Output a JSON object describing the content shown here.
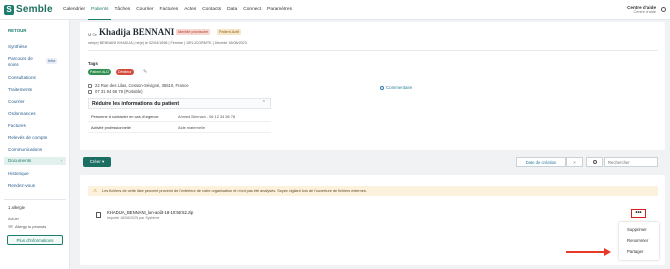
{
  "app": {
    "logo_mark": "S",
    "logo_text": "Semble",
    "accent": "#1e7e6e",
    "clinic_name": "Centre d'aide",
    "clinic_sub": "Centre d'aide"
  },
  "nav": {
    "items": [
      {
        "label": "Calendrier"
      },
      {
        "label": "Patients"
      },
      {
        "label": "Tâches"
      },
      {
        "label": "Courrier"
      },
      {
        "label": "Factures"
      },
      {
        "label": "Actes"
      },
      {
        "label": "Contacts"
      },
      {
        "label": "Data"
      },
      {
        "label": "Connect"
      },
      {
        "label": "Paramètres"
      }
    ],
    "active": "Patients"
  },
  "sidebar": {
    "back_label": "RETOUR",
    "items": [
      {
        "label": "Synthèse"
      },
      {
        "label": "Parcours de"
      },
      {
        "label": "soins"
      },
      {
        "label": "Consultations"
      },
      {
        "label": "Traitements"
      },
      {
        "label": "Courrier"
      },
      {
        "label": "Ordonnances"
      },
      {
        "label": "Factures"
      },
      {
        "label": "Relevés de compte"
      },
      {
        "label": "Communications"
      },
      {
        "label": "Documents"
      },
      {
        "label": "Historique"
      },
      {
        "label": "Rendez-vous"
      }
    ],
    "beta_label": "béta",
    "active_chevron": "›",
    "alert_count": "1 allergie",
    "alert_status": "Actuel",
    "allergy": "Allergy to peanuts",
    "more_info_button": "Plus d'informations"
  },
  "patient": {
    "sex": "M Or",
    "name": "Khadija BENNANI",
    "badges": {
      "provisional": "Identité provisoire",
      "active": "Patient Actif"
    },
    "meta": "née(e) BENNANI KHADIJA | né(e) le 02/04/1998 | Femme | 1IRLJCGRMTK | Décédé 18/08/2023",
    "tags_title": "Tags",
    "tags": [
      {
        "label": "Patient ALD",
        "color": "#2f8f4e"
      },
      {
        "label": "Débiteur",
        "color": "#d24b3c"
      }
    ],
    "address": "22 Rue des Lilas, Cesson-Sévigné, 35510, France",
    "phone": "07 31 94 66 78 (Portable)",
    "comment_link": "Commentaire",
    "collapse_title": "Réduire les informations du patient",
    "info": [
      {
        "key": "Personne à contacter en cas d'urgence",
        "value": "Ahmed Bennani - 06 12 34 56 78"
      },
      {
        "key": "Activité professionnelle",
        "value": "Aide maternelle"
      }
    ]
  },
  "toolbar": {
    "create_button": "Créer ▾",
    "date_button": "Date de création",
    "clear": "×",
    "search_placeholder": "Rechercher"
  },
  "documents": {
    "warning": "Les fichiers de cette liste peuvent provenir de l'extérieur de votre organisation et n'ont pas été analysés. Soyez vigilant lors de l'ouverture de fichiers externes.",
    "warning_icon": "⚠",
    "files": [
      {
        "name": "KHADIJA_BENNANI_lun-août-18-10:56:52.zip",
        "sub": "Importé 18/08/2025 par Système"
      }
    ],
    "menu_button": "•••",
    "menu_items": [
      {
        "label": "Supprimer"
      },
      {
        "label": "Renommer"
      },
      {
        "label": "Partager"
      }
    ]
  }
}
